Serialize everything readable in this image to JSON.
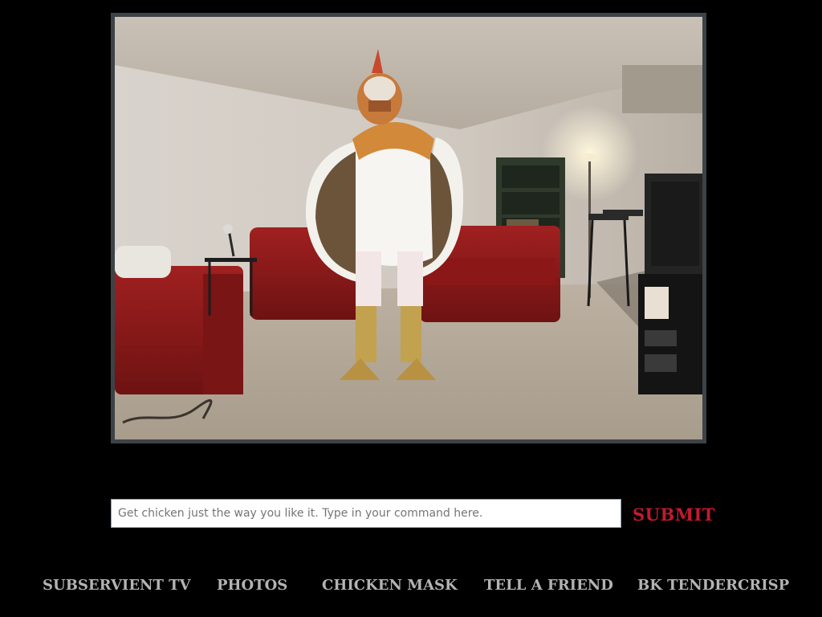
{
  "command": {
    "placeholder": "Get chicken just the way you like it. Type in your command here.",
    "submit_label": "SUBMIT"
  },
  "nav": {
    "items": [
      {
        "label": "SUBSERVIENT TV"
      },
      {
        "label": "PHOTOS"
      },
      {
        "label": "CHICKEN MASK"
      },
      {
        "label": "TELL A FRIEND"
      },
      {
        "label": "BK TENDERCRISP"
      }
    ]
  },
  "colors": {
    "background": "#000000",
    "accent": "#c21a2f",
    "nav_text": "#b3b3b3",
    "frame": "#3d4246"
  },
  "video": {
    "scene": "chicken-in-living-room"
  }
}
